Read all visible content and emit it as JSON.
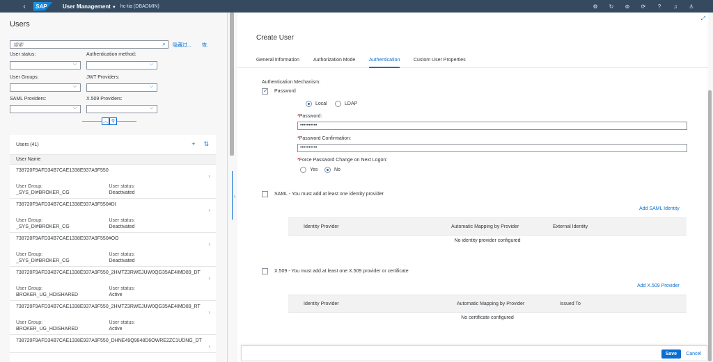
{
  "shell": {
    "back_icon": "back-icon",
    "logo": "SAP",
    "title": "User Management",
    "context": "hc-tia (DBADMIN)",
    "icons": [
      "settings-icon",
      "refresh-icon",
      "navigate-icon",
      "sync-icon",
      "help-icon",
      "notification-icon",
      "user-icon"
    ]
  },
  "left": {
    "heading": "Users",
    "search_placeholder": "搜索",
    "hide_filter": "隐藏过...",
    "restore": "恢.",
    "filters": {
      "user_status": "User status:",
      "auth_method": "Authentication method:",
      "user_groups": "User Groups:",
      "jwt": "JWT Providers:",
      "saml": "SAML Providers:",
      "x509": "X.509 Providers:"
    },
    "list_title": "Users (41)",
    "col_header": "User Name",
    "group_label": "User Group:",
    "status_label": "User status:",
    "rows": [
      {
        "name": "738720F9AFD34B7CAE1338E937A9F550",
        "group": "_SYS_DI#BROKER_CG",
        "status": "Deactivated"
      },
      {
        "name": "738720F9AFD34B7CAE1338E937A9F550#DI",
        "group": "_SYS_DI#BROKER_CG",
        "status": "Deactivated"
      },
      {
        "name": "738720F9AFD34B7CAE1338E937A9F550#OO",
        "group": "_SYS_DI#BROKER_CG",
        "status": "Deactivated"
      },
      {
        "name": "738720F9AFD34B7CAE1338E937A9F550_2HMTZ3RWEJUW0QG35AE4IMD89_DT",
        "group": "BROKER_UG_HDISHARED",
        "status": "Active"
      },
      {
        "name": "738720F9AFD34B7CAE1338E937A9F550_2HMTZ3RWEJUW0QG35AE4IMD89_RT",
        "group": "BROKER_UG_HDISHARED",
        "status": "Active"
      },
      {
        "name": "738720F9AFD34B7CAE1338E937A9F550_DHNE49Q9848D6OWRE2ZC1UDNG_DT",
        "group": "",
        "status": ""
      }
    ]
  },
  "right": {
    "title": "Create User",
    "tabs": [
      "General Information",
      "Authorization Mode",
      "Authentication",
      "Custom User Properties"
    ],
    "active_tab": "Authentication",
    "auth_mechanism": "Authentication Mechanism:",
    "password_cb": "Password",
    "local": "Local",
    "ldap": "LDAP",
    "password_label": "Password:",
    "password_value": "••••••••••",
    "confirm_label": "Password Confirmation:",
    "confirm_value": "••••••••••",
    "force_label": "Force Password Change on Next Logon:",
    "yes": "Yes",
    "no": "No",
    "req_mark": "*",
    "saml_cb": "SAML - You must add at least one identity provider",
    "add_saml": "Add SAML Identity",
    "saml_cols": [
      "Identity Provider",
      "Automatic Mapping by Provider",
      "External Identity"
    ],
    "saml_empty": "No identity provider configured",
    "x509_cb": "X.509 - You must add at least one X.509 provider or certificate",
    "add_x509": "Add X.509 Provider",
    "x509_cols": [
      "Identity Provider",
      "Automatic Mapping by Provider",
      "Issued To"
    ],
    "x509_empty": "No certificate configured",
    "save": "Save",
    "cancel": "Cancel"
  }
}
